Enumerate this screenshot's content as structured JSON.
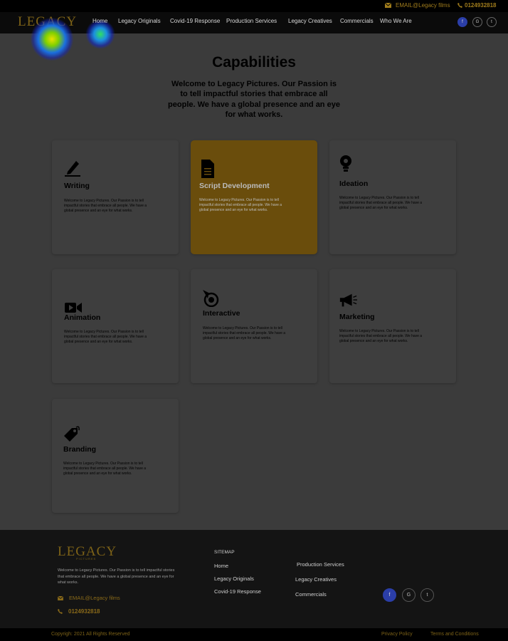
{
  "topbar": {
    "email": "EMAIL@Legacy films",
    "phone": "0124932818"
  },
  "nav": {
    "logo_text": "LEGACY",
    "logo_sub": "PICTURES",
    "items": [
      "Home",
      "Legacy Originals",
      "Covid-19 Response",
      "Production  Services",
      "Legacy Creatives",
      "Commercials",
      "Who We Are"
    ],
    "social": [
      "f",
      "G",
      "t"
    ]
  },
  "main": {
    "title": "Capabilities",
    "intro": "Welcome to Legacy Pictures. Our Passion is to tell impactful stories that embrace all people. We have a global presence and an eye for what works."
  },
  "cards": [
    {
      "title": "Writing",
      "icon": "pen-icon",
      "desc": "Welcome to Legacy Pictures. Our Passion is to tell impactful stories that embrace all people. We have a global presence and an eye for what works."
    },
    {
      "title": "Script Development",
      "icon": "document-icon",
      "desc": "Welcome to Legacy Pictures. Our Passion is to tell impactful stories that embrace all people. We have a global presence and an eye for what works."
    },
    {
      "title": "Ideation",
      "icon": "lightbulb-icon",
      "desc": "Welcome to Legacy Pictures. Our Passion is to tell impactful stories that embrace all people. We have a global presence and an eye for what works."
    },
    {
      "title": "Animation",
      "icon": "video-camera-icon",
      "desc": "Welcome to Legacy Pictures. Our Passion is to tell impactful stories that embrace all people. We have a global presence and an eye for what works."
    },
    {
      "title": "Interactive",
      "icon": "pointer-target-icon",
      "desc": "Welcome to Legacy Pictures. Our Passion is to tell impactful stories that embrace all people. We have a global presence and an eye for what works."
    },
    {
      "title": "Marketing",
      "icon": "megaphone-icon",
      "desc": "Welcome to Legacy Pictures. Our Passion is to tell impactful stories that embrace all people. We have a global presence and an eye for what works."
    },
    {
      "title": "Branding",
      "icon": "tag-icon",
      "desc": "Welcome to Legacy Pictures. Our Passion is to tell impactful stories that embrace all people. We have a global presence and an eye for what works."
    }
  ],
  "footer": {
    "logo_text": "LEGACY",
    "logo_sub": "PICTURES",
    "desc": "Welcome to Legacy Pictures. Our Passion is to tell impactful stories that embrace all people. We have a global presence and an eye for what works.",
    "email": "EMAIL@Legacy films",
    "phone": "0124932818",
    "sitemap_label": "SITEMAP",
    "col1": [
      "Home",
      "Legacy Originals",
      "Covid-19 Response"
    ],
    "col2": [
      "Production  Services",
      "Legacy Creatives",
      "Commercials"
    ],
    "social": [
      "f",
      "G",
      "t"
    ]
  },
  "bottom": {
    "copyright": "Copyrigh: 2021 All Rights Reserved",
    "privacy": "Privacy Policy",
    "terms": "Terms and Conditions"
  },
  "colors": {
    "accent_gold": "#a07c1c",
    "active_card": "#6a4d0c",
    "facebook": "#2b3ea8"
  }
}
